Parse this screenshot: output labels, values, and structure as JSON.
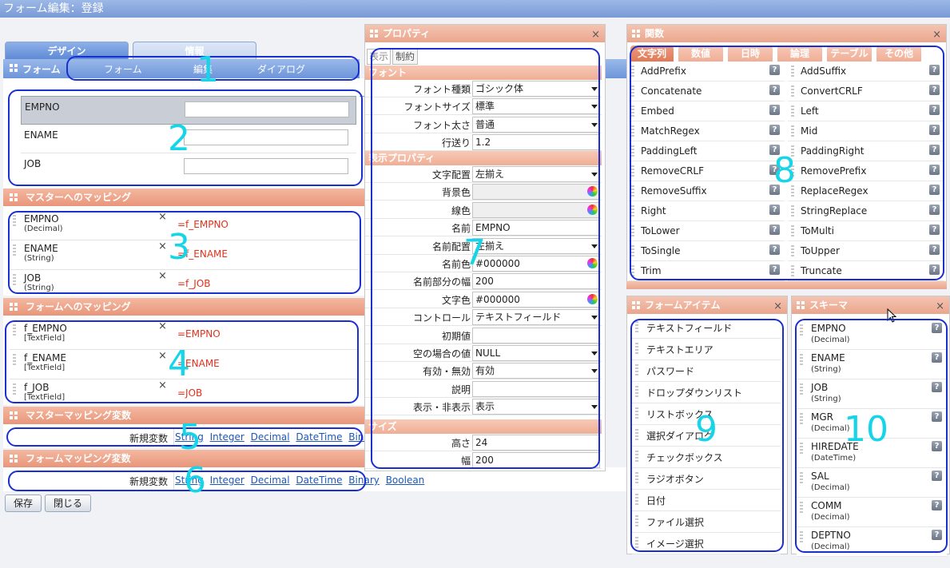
{
  "window": {
    "title": "フォーム編集：登録"
  },
  "top_tabs": [
    {
      "label": "デザイン"
    },
    {
      "label": "情報"
    }
  ],
  "form_section": {
    "title": "フォーム",
    "subtabs": [
      "フォーム",
      "編集",
      "ダイアログ"
    ],
    "fields": [
      {
        "label": "EMPNO",
        "value": ""
      },
      {
        "label": "ENAME",
        "value": ""
      },
      {
        "label": "JOB",
        "value": ""
      }
    ]
  },
  "master_mapping": {
    "title": "マスターへのマッピング",
    "rows": [
      {
        "name": "EMPNO",
        "type": "(Decimal)",
        "expr": "=f_EMPNO"
      },
      {
        "name": "ENAME",
        "type": "(String)",
        "expr": "=f_ENAME"
      },
      {
        "name": "JOB",
        "type": "(String)",
        "expr": "=f_JOB"
      }
    ]
  },
  "form_mapping": {
    "title": "フォームへのマッピング",
    "rows": [
      {
        "name": "f_EMPNO",
        "type": "[TextField]",
        "expr": "=EMPNO"
      },
      {
        "name": "f_ENAME",
        "type": "[TextField]",
        "expr": "=ENAME"
      },
      {
        "name": "f_JOB",
        "type": "[TextField]",
        "expr": "=JOB"
      }
    ]
  },
  "master_vars": {
    "title": "マスターマッピング変数",
    "new_label": "新規変数",
    "types": [
      "String",
      "Integer",
      "Decimal",
      "DateTime",
      "Binary"
    ]
  },
  "form_vars": {
    "title": "フォームマッピング変数",
    "new_label": "新規変数",
    "types": [
      "String",
      "Integer",
      "Decimal",
      "DateTime",
      "Binary",
      "Boolean"
    ]
  },
  "buttons": {
    "save": "保存",
    "close": "閉じる"
  },
  "properties": {
    "title": "プロパティ",
    "tabs": [
      "表示",
      "制約"
    ],
    "section_font": "フォント",
    "section_display": "表示プロパティ",
    "section_size": "サイズ",
    "font_rows": [
      {
        "key": "フォント種類",
        "value": "ゴシック体"
      },
      {
        "key": "フォントサイズ",
        "value": "標準"
      },
      {
        "key": "フォント太さ",
        "value": "普通"
      },
      {
        "key": "行送り",
        "value": "1.2"
      }
    ],
    "display_rows": [
      {
        "key": "文字配置",
        "value": "左揃え"
      },
      {
        "key": "背景色",
        "value": ""
      },
      {
        "key": "線色",
        "value": ""
      },
      {
        "key": "名前",
        "value": "EMPNO"
      },
      {
        "key": "名前配置",
        "value": "左揃え"
      },
      {
        "key": "名前色",
        "value": "#000000"
      },
      {
        "key": "名前部分の幅",
        "value": "200"
      },
      {
        "key": "文字色",
        "value": "#000000"
      },
      {
        "key": "コントロール",
        "value": "テキストフィールド"
      },
      {
        "key": "初期値",
        "value": ""
      },
      {
        "key": "空の場合の値",
        "value": "NULL"
      },
      {
        "key": "有効・無効",
        "value": "有効"
      },
      {
        "key": "説明",
        "value": ""
      },
      {
        "key": "表示・非表示",
        "value": "表示"
      }
    ],
    "size_rows": [
      {
        "key": "高さ",
        "value": "24"
      },
      {
        "key": "幅",
        "value": "200"
      }
    ]
  },
  "functions": {
    "title": "関数",
    "tabs": [
      "文字列",
      "数値",
      "日時",
      "論理",
      "テーブル",
      "その他"
    ],
    "left": [
      "AddPrefix",
      "Concatenate",
      "Embed",
      "MatchRegex",
      "PaddingLeft",
      "RemoveCRLF",
      "RemoveSuffix",
      "Right",
      "ToLower",
      "ToSingle",
      "Trim"
    ],
    "right": [
      "AddSuffix",
      "ConvertCRLF",
      "Left",
      "Mid",
      "PaddingRight",
      "RemovePrefix",
      "ReplaceRegex",
      "StringReplace",
      "ToMulti",
      "ToUpper",
      "Truncate"
    ]
  },
  "form_items": {
    "title": "フォームアイテム",
    "items": [
      "テキストフィールド",
      "テキストエリア",
      "パスワード",
      "ドロップダウンリスト",
      "リストボックス",
      "選択ダイアログ",
      "チェックボックス",
      "ラジオボタン",
      "日付",
      "ファイル選択",
      "イメージ選択"
    ]
  },
  "schema": {
    "title": "スキーマ",
    "items": [
      {
        "name": "EMPNO",
        "type": "(Decimal)"
      },
      {
        "name": "ENAME",
        "type": "(String)"
      },
      {
        "name": "JOB",
        "type": "(String)"
      },
      {
        "name": "MGR",
        "type": "(Decimal)"
      },
      {
        "name": "HIREDATE",
        "type": "(DateTime)"
      },
      {
        "name": "SAL",
        "type": "(Decimal)"
      },
      {
        "name": "COMM",
        "type": "(Decimal)"
      },
      {
        "name": "DEPTNO",
        "type": "(Decimal)"
      }
    ]
  },
  "annotations": [
    "1",
    "2",
    "3",
    "4",
    "5",
    "6",
    "7",
    "8",
    "9",
    "10"
  ],
  "colors": {
    "highlight": "#1a2fd0",
    "annotation": "#16d5e8",
    "section_header": "#e8967a",
    "mapping_expr": "#e0321c"
  }
}
